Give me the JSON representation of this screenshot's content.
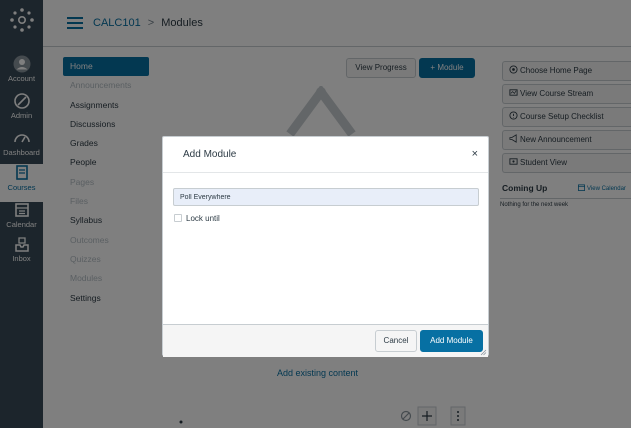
{
  "global_nav": {
    "items": [
      {
        "label": "Account",
        "icon": "avatar-icon"
      },
      {
        "label": "Admin",
        "icon": "admin-icon"
      },
      {
        "label": "Dashboard",
        "icon": "dashboard-icon"
      },
      {
        "label": "Courses",
        "icon": "courses-icon",
        "active": true
      },
      {
        "label": "Calendar",
        "icon": "calendar-icon"
      },
      {
        "label": "Inbox",
        "icon": "inbox-icon"
      }
    ]
  },
  "header": {
    "course": "CALC101",
    "separator": ">",
    "page": "Modules"
  },
  "course_nav": {
    "items": [
      {
        "label": "Home",
        "state": "active"
      },
      {
        "label": "Announcements",
        "state": "dim"
      },
      {
        "label": "Assignments",
        "state": "normal"
      },
      {
        "label": "Discussions",
        "state": "normal"
      },
      {
        "label": "Grades",
        "state": "normal"
      },
      {
        "label": "People",
        "state": "normal"
      },
      {
        "label": "Pages",
        "state": "dim"
      },
      {
        "label": "Files",
        "state": "dim"
      },
      {
        "label": "Syllabus",
        "state": "normal"
      },
      {
        "label": "Outcomes",
        "state": "dim"
      },
      {
        "label": "Quizzes",
        "state": "dim"
      },
      {
        "label": "Modules",
        "state": "dim"
      },
      {
        "label": "Settings",
        "state": "normal"
      }
    ]
  },
  "toolbar": {
    "view_progress": "View Progress",
    "add_module": "+ Module"
  },
  "sidebar": {
    "buttons": [
      {
        "label": "Choose Home Page",
        "icon": "home-page-icon"
      },
      {
        "label": "View Course Stream",
        "icon": "stream-icon"
      },
      {
        "label": "Course Setup Checklist",
        "icon": "checklist-icon"
      },
      {
        "label": "New Announcement",
        "icon": "announcement-icon"
      },
      {
        "label": "Student View",
        "icon": "student-view-icon"
      }
    ],
    "coming_up": {
      "title": "Coming Up",
      "view_calendar": "View Calendar",
      "empty_text": "Nothing for the next week"
    }
  },
  "main": {
    "add_existing": "Add existing content"
  },
  "modal": {
    "title": "Add Module",
    "close": "×",
    "module_name_value": "Poll Everywhere",
    "lock_label": "Lock until",
    "cancel": "Cancel",
    "submit": "Add Module"
  },
  "colors": {
    "brand": "#0770a3",
    "nav_bg": "#394b58",
    "overlay": "rgba(0,0,0,0.5)"
  }
}
